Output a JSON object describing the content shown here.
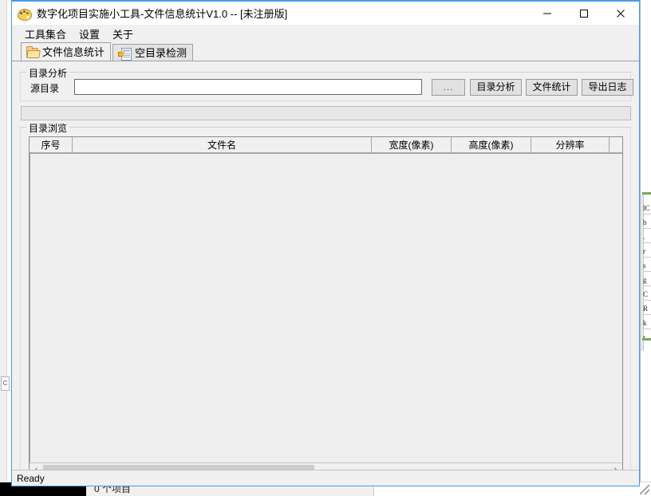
{
  "window": {
    "title": "数字化项目实施小工具-文件信息统计V1.0 -- [未注册版]",
    "app_icon": "palette-icon",
    "controls": {
      "minimize": "minimize-icon",
      "maximize": "maximize-icon",
      "close": "close-icon"
    }
  },
  "menubar": {
    "items": [
      {
        "label": "工具集合"
      },
      {
        "label": "设置"
      },
      {
        "label": "关于"
      }
    ]
  },
  "tabs": [
    {
      "label": "文件信息统计",
      "icon": "folder-icon",
      "active": true
    },
    {
      "label": "空目录检测",
      "icon": "arrow-document-icon",
      "active": false
    }
  ],
  "analysis_group": {
    "title": "目录分析",
    "source_label": "源目录",
    "source_value": "",
    "source_placeholder": "",
    "buttons": [
      {
        "name": "browse",
        "label": "..."
      },
      {
        "name": "analyze",
        "label": "目录分析"
      },
      {
        "name": "stats",
        "label": "文件统计"
      },
      {
        "name": "export",
        "label": "导出日志"
      }
    ]
  },
  "progress": {
    "value": 0,
    "label": ""
  },
  "browse_group": {
    "title": "目录浏览",
    "table": {
      "columns": [
        "序号",
        "文件名",
        "宽度(像素)",
        "高度(像素)",
        "分辨率",
        ""
      ],
      "rows": []
    },
    "scrollbar": {
      "left_arrow": "chevron-left-icon",
      "right_arrow": "chevron-right-icon",
      "thumb_fraction": 0.48
    }
  },
  "statusbar": {
    "text": "Ready"
  },
  "taskbar": {
    "item_count": "0 个项目"
  },
  "background_window": {
    "right_text": "lC\nb\n.\nr\ns\ng\nC\nR\nk\nr"
  },
  "colors": {
    "window_border": "#4a9ae0",
    "face": "#f0f0f0",
    "button_face": "#e1e1e1",
    "field": "#ffffff",
    "scroll_thumb": "#cdcdcd",
    "folder_icon": "#f3d08a",
    "arrow_icon": "#f6bb1c"
  }
}
